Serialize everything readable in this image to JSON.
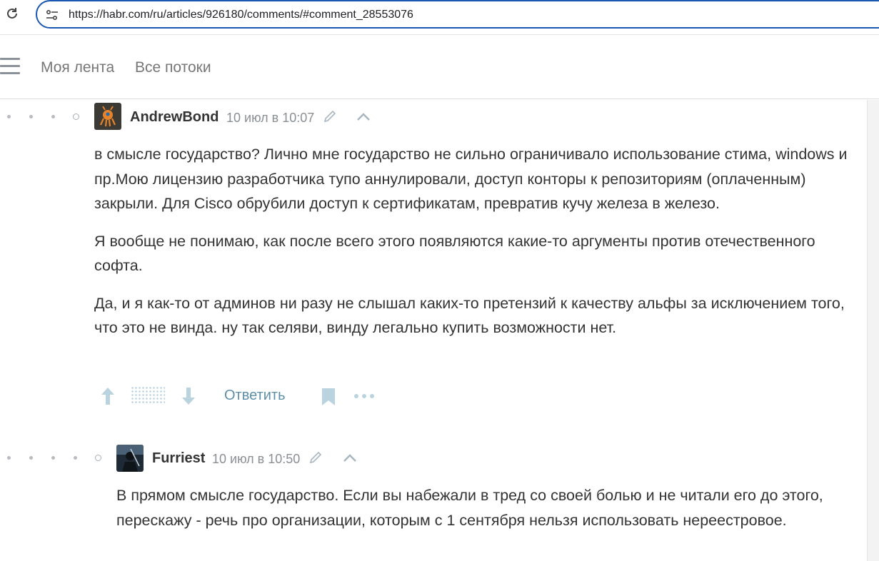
{
  "browser": {
    "url": "https://habr.com/ru/articles/926180/comments/#comment_28553076",
    "reload_icon": "reload-icon",
    "site_info_icon": "site-settings-icon"
  },
  "header": {
    "menu_icon": "hamburger-menu-icon",
    "nav": [
      "Моя лента",
      "Все потоки"
    ]
  },
  "comments": [
    {
      "author": "AndrewBond",
      "date": "10 июл в 10:07",
      "paragraphs": [
        "в смысле государство? Лично мне государство не сильно ограничивало использование стима, windows и пр.Мою лицензию разработчика тупо аннулировали, доступ конторы к репозиториям (оплаченным) закрыли. Для Cisco обрубили доступ к сертификатам, превратив кучу железа в железо.",
        "Я вообще не понимаю, как после всего этого появляются какие-то аргументы против отечественного софта.",
        "Да, и я как-то от админов ни разу не слышал каких-то претензий к качеству альфы за исключением того, что это не винда. ну так селяви, винду легально купить возможности нет."
      ],
      "actions": {
        "reply": "Ответить"
      }
    },
    {
      "author": "Furriest",
      "date": "10 июл в 10:50",
      "paragraphs": [
        "В прямом смысле государство. Если вы набежали в тред со своей болью и не читали его до этого, перескажу - речь про организации, которым с 1 сентября нельзя использовать нереестровое."
      ]
    }
  ],
  "colors": {
    "accent_link": "#5e8fa8",
    "url_focus_border": "#1a57b0",
    "muted_text": "#8a8f94"
  }
}
